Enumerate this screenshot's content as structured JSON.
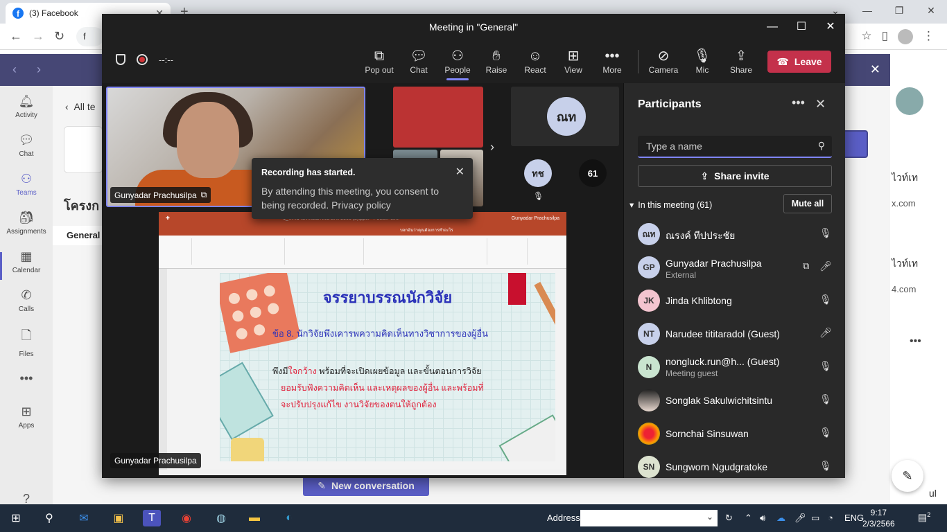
{
  "browser": {
    "tab_title": "(3) Facebook",
    "address_fragment": "f"
  },
  "teams_bg": {
    "rail": [
      {
        "label": "Activity",
        "icon": "bell-icon"
      },
      {
        "label": "Chat",
        "icon": "chat-icon"
      },
      {
        "label": "Teams",
        "icon": "teams-icon"
      },
      {
        "label": "Assignments",
        "icon": "assignments-icon"
      },
      {
        "label": "Calendar",
        "icon": "calendar-icon"
      },
      {
        "label": "Calls",
        "icon": "phone-icon"
      },
      {
        "label": "Files",
        "icon": "file-icon"
      },
      {
        "label": "Apps",
        "icon": "apps-icon"
      }
    ],
    "back_label": "All te",
    "team_name": "โครงก",
    "channel": "General",
    "new_conversation": "New conversation",
    "right_fragments": [
      "ไวท์เท",
      "x.com",
      "ไวท์เท",
      "4.com",
      "ul"
    ]
  },
  "meeting": {
    "title": "Meeting in \"General\"",
    "timer": "--:--",
    "toolbar": {
      "popout": "Pop out",
      "chat": "Chat",
      "people": "People",
      "raise": "Raise",
      "react": "React",
      "view": "View",
      "more": "More",
      "camera": "Camera",
      "mic": "Mic",
      "share": "Share",
      "leave": "Leave"
    },
    "main_video_name": "Gunyadar Prachusilpa",
    "share_name": "Gunyadar Prachusilpa",
    "avatar_big": "ณท",
    "avatar_small": "ทช",
    "overflow_count": "61",
    "toast": {
      "title": "Recording has started.",
      "body": "By attending this meeting, you consent to being recorded. Privacy policy"
    }
  },
  "slide": {
    "title": "จรรยาบรรณนักวิจัย",
    "point": "ข้อ 8. นักวิจัยพึงเคารพความคิดเห็นทางวิชาการของผู้อื่น",
    "body_prefix": "พึงมี",
    "body_highlight": "ใจกว้าง",
    "body_rest": " พร้อมที่จะเปิดเผยข้อมูล และขั้นตอนการวิจัย",
    "red_line1": "ยอมรับฟังความคิดเห็น และเหตุผลของผู้อื่น และพร้อมที่",
    "red_line2": "จะปรับปรุงแก้ไข งานวิจัยของตนให้ถูกต้อง",
    "ppt_title": "1_จรรยาบรรณนักวิจัย ม.ร. 2566 (2).pptx - PowerPoint",
    "ppt_user": "Gunyadar Prachusilpa",
    "ppt_search": "บอกฉันว่าคุณต้องการทำอะไร"
  },
  "participants": {
    "title": "Participants",
    "search_placeholder": "Type a name",
    "share_invite": "Share invite",
    "section": "In this meeting (61)",
    "mute_all": "Mute all",
    "list": [
      {
        "initials": "ณท",
        "name": "ณรงค์ ทีปประชัย",
        "sub": "",
        "mic": "muted"
      },
      {
        "initials": "GP",
        "name": "Gunyadar Prachusilpa",
        "sub": "External",
        "mic": "on"
      },
      {
        "initials": "JK",
        "name": "Jinda Khlibtong",
        "sub": "",
        "mic": "muted"
      },
      {
        "initials": "NT",
        "name": "Narudee tititaradol (Guest)",
        "sub": "",
        "mic": "on"
      },
      {
        "initials": "N",
        "name": "nongluck.run@h... (Guest)",
        "sub": "Meeting guest",
        "mic": "muted"
      },
      {
        "initials": "",
        "name": "Songlak Sakulwichitsintu",
        "sub": "",
        "mic": "muted"
      },
      {
        "initials": "",
        "name": "Sornchai Sinsuwan",
        "sub": "",
        "mic": "muted"
      },
      {
        "initials": "SN",
        "name": "Sungworn Ngudgratoke",
        "sub": "",
        "mic": "muted"
      }
    ]
  },
  "taskbar": {
    "address_label": "Address",
    "lang": "ENG",
    "time": "9:17",
    "date": "2/3/2566",
    "notif_count": "2"
  }
}
